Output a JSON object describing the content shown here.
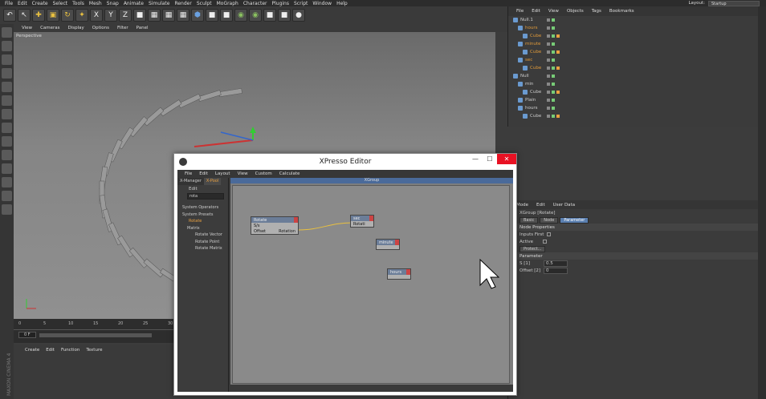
{
  "menubar": [
    "File",
    "Edit",
    "Create",
    "Select",
    "Tools",
    "Mesh",
    "Snap",
    "Animate",
    "Simulate",
    "Render",
    "Sculpt",
    "MoGraph",
    "Character",
    "Plugins",
    "Script",
    "Window",
    "Help"
  ],
  "layout": {
    "label": "Layout:",
    "value": "Startup"
  },
  "toolbar": {
    "icons": [
      "undo-icon",
      "select-icon",
      "move-icon",
      "scale-icon",
      "rotate-icon",
      "transform-icon",
      "x-axis-icon",
      "y-axis-icon",
      "z-axis-icon",
      "world-icon",
      "render-view-icon",
      "render-icon",
      "render-settings-icon",
      "cube-icon",
      "spline-icon",
      "nurbs-icon",
      "mograph-icon",
      "deformer-icon",
      "floor-icon",
      "camera-icon",
      "light-icon"
    ],
    "axis_x": "X",
    "axis_y": "Y",
    "axis_z": "Z"
  },
  "viewport": {
    "menu": [
      "View",
      "Cameras",
      "Display",
      "Options",
      "Filter",
      "Panel"
    ],
    "label": "Perspective"
  },
  "timeline": {
    "ticks": [
      "0",
      "5",
      "10",
      "15",
      "20",
      "25",
      "30"
    ],
    "frame": "0 F"
  },
  "bottom_menu": [
    "Create",
    "Edit",
    "Function",
    "Texture"
  ],
  "objects": {
    "menu": [
      "File",
      "Edit",
      "View",
      "Objects",
      "Tags",
      "Bookmarks"
    ],
    "rows": [
      {
        "name": "Null.1",
        "indent": 0,
        "orange": false
      },
      {
        "name": "hours",
        "indent": 1,
        "orange": true
      },
      {
        "name": "Cube",
        "indent": 2,
        "orange": true
      },
      {
        "name": "minute",
        "indent": 1,
        "orange": true
      },
      {
        "name": "Cube",
        "indent": 2,
        "orange": true
      },
      {
        "name": "sec",
        "indent": 1,
        "orange": true
      },
      {
        "name": "Cube",
        "indent": 2,
        "orange": true
      },
      {
        "name": "Null",
        "indent": 0,
        "orange": false
      },
      {
        "name": "min",
        "indent": 1,
        "orange": false
      },
      {
        "name": "Cube",
        "indent": 2,
        "orange": false
      },
      {
        "name": "Plain",
        "indent": 1,
        "orange": false
      },
      {
        "name": "hours",
        "indent": 1,
        "orange": false
      },
      {
        "name": "Cube",
        "indent": 2,
        "orange": false
      }
    ]
  },
  "attributes": {
    "menu": [
      "Mode",
      "Edit",
      "User Data"
    ],
    "title": "XGroup [Rotate]",
    "tabs": [
      "Basic",
      "Node",
      "Parameter"
    ],
    "section1": "Node Properties",
    "inputs_first": "Inputs First",
    "active": "Active",
    "protect": "Protect...",
    "section2": "Parameter",
    "param1_label": "S [1]",
    "param1_value": "0.5",
    "param2_label": "Offset [2]",
    "param2_value": "0"
  },
  "xpresso": {
    "title": "XPresso Editor",
    "menu": [
      "File",
      "Edit",
      "Layout",
      "View",
      "Custom",
      "Calculate"
    ],
    "tabs": [
      "X-Manager",
      "X-Pool"
    ],
    "edit": "Edit",
    "search": "rota",
    "tree": [
      {
        "label": "System Operators",
        "orange": false
      },
      {
        "label": "System Presets",
        "orange": false
      },
      {
        "label": "Rotate",
        "orange": true
      },
      {
        "label": "Matrix",
        "orange": false
      },
      {
        "label": "Rotate Vector",
        "orange": false
      },
      {
        "label": "Rotate Point",
        "orange": false
      },
      {
        "label": "Rotate Matrix",
        "orange": false
      }
    ],
    "group_title": "XGroup",
    "nodes": {
      "rotate": {
        "title": "Rotate",
        "in1": "S/s",
        "in2": "Offset",
        "out": "Rotation"
      },
      "sec": {
        "title": "sec",
        "port": "Rotati"
      },
      "minute": {
        "title": "minute"
      },
      "hours": {
        "title": "hours"
      }
    }
  }
}
